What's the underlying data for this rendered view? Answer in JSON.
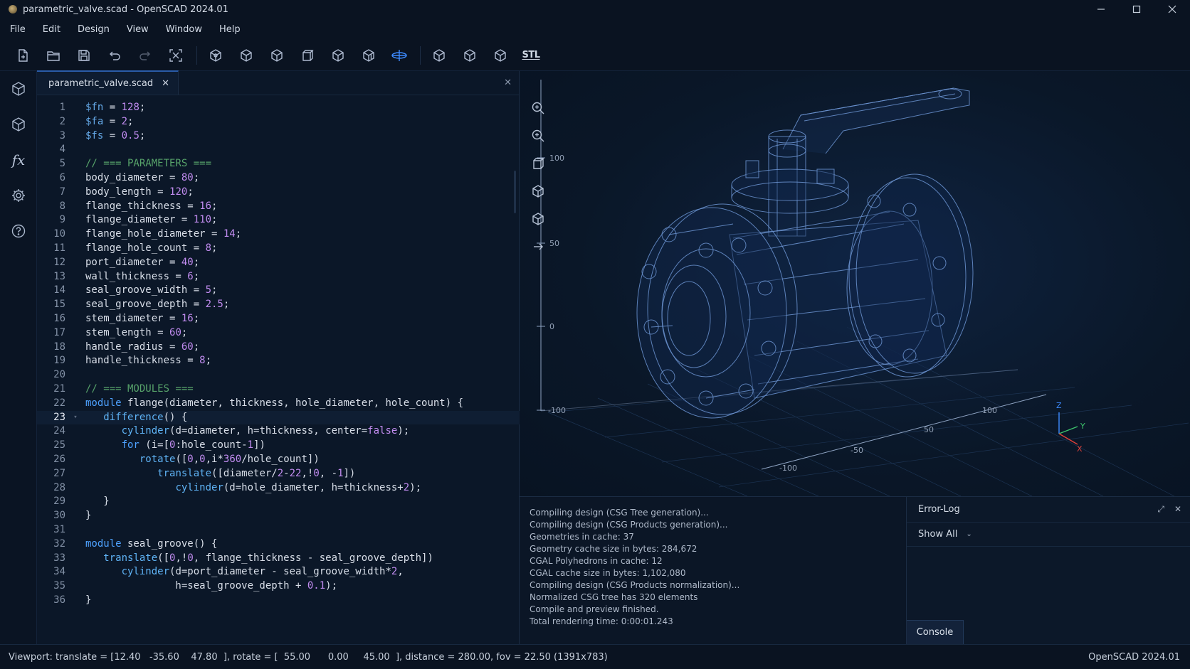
{
  "window": {
    "title": "parametric_valve.scad - OpenSCAD 2024.01",
    "controls": [
      "minimize",
      "maximize",
      "close"
    ]
  },
  "menu": [
    "File",
    "Edit",
    "Design",
    "View",
    "Window",
    "Help"
  ],
  "toolbar": {
    "stl_label": "STL",
    "active_tool": "axes"
  },
  "editor": {
    "tab_name": "parametric_valve.scad",
    "current_line": 23,
    "lines": [
      {
        "n": "1",
        "html": "<span class='tok-var'>$fn</span> = <span class='tok-num'>128</span>;"
      },
      {
        "n": "2",
        "html": "<span class='tok-var'>$fa</span> = <span class='tok-num'>2</span>;"
      },
      {
        "n": "3",
        "html": "<span class='tok-var'>$fs</span> = <span class='tok-num'>0.5</span>;"
      },
      {
        "n": "4",
        "html": ""
      },
      {
        "n": "5",
        "html": "<span class='tok-cmt'>// === PARAMETERS ===</span>"
      },
      {
        "n": "6",
        "html": "body_diameter = <span class='tok-num'>80</span>;"
      },
      {
        "n": "7",
        "html": "body_length = <span class='tok-num'>120</span>;"
      },
      {
        "n": "8",
        "html": "flange_thickness = <span class='tok-num'>16</span>;"
      },
      {
        "n": "9",
        "html": "flange_diameter = <span class='tok-num'>110</span>;"
      },
      {
        "n": "10",
        "html": "flange_hole_diameter = <span class='tok-num'>14</span>;"
      },
      {
        "n": "11",
        "html": "flange_hole_count = <span class='tok-num'>8</span>;"
      },
      {
        "n": "12",
        "html": "port_diameter = <span class='tok-num'>40</span>;"
      },
      {
        "n": "13",
        "html": "wall_thickness = <span class='tok-num'>6</span>;"
      },
      {
        "n": "14",
        "html": "seal_groove_width = <span class='tok-num'>5</span>;"
      },
      {
        "n": "15",
        "html": "seal_groove_depth = <span class='tok-num'>2.5</span>;"
      },
      {
        "n": "16",
        "html": "stem_diameter = <span class='tok-num'>16</span>;"
      },
      {
        "n": "17",
        "html": "stem_length = <span class='tok-num'>60</span>;"
      },
      {
        "n": "18",
        "html": "handle_radius = <span class='tok-num'>60</span>;"
      },
      {
        "n": "19",
        "html": "handle_thickness = <span class='tok-num'>8</span>;"
      },
      {
        "n": "20",
        "html": ""
      },
      {
        "n": "21",
        "html": "<span class='tok-cmt'>// === MODULES ===</span>"
      },
      {
        "n": "22",
        "html": "<span class='tok-kw'>module</span> flange(diameter, thickness, hole_diameter, hole_count) {"
      },
      {
        "n": "23",
        "html": "   <span class='tok-fn'>difference</span>() {"
      },
      {
        "n": "24",
        "html": "      <span class='tok-fn'>cylinder</span>(d=diameter, h=thickness, center=<span class='tok-num'>false</span>);"
      },
      {
        "n": "25",
        "html": "      <span class='tok-kw'>for</span> (i=[<span class='tok-num'>0</span>:hole_count-<span class='tok-num'>1</span>])"
      },
      {
        "n": "26",
        "html": "         <span class='tok-fn'>rotate</span>([<span class='tok-num'>0</span>,<span class='tok-num'>0</span>,i*<span class='tok-num'>360</span>/hole_count])"
      },
      {
        "n": "27",
        "html": "            <span class='tok-fn'>translate</span>([diameter/<span class='tok-num'>2</span>-<span class='tok-num'>22</span>,!<span class='tok-num'>0</span>, -<span class='tok-num'>1</span>])"
      },
      {
        "n": "28",
        "html": "               <span class='tok-fn'>cylinder</span>(d=hole_diameter, h=thickness+<span class='tok-num'>2</span>);"
      },
      {
        "n": "29",
        "html": "   }"
      },
      {
        "n": "30",
        "html": "}"
      },
      {
        "n": "31",
        "html": ""
      },
      {
        "n": "32",
        "html": "<span class='tok-kw'>module</span> seal_groove() {"
      },
      {
        "n": "33",
        "html": "   <span class='tok-fn'>translate</span>([<span class='tok-num'>0</span>,!<span class='tok-num'>0</span>, flange_thickness - seal_groove_depth])"
      },
      {
        "n": "34",
        "html": "      <span class='tok-fn'>cylinder</span>(d=port_diameter - seal_groove_width*<span class='tok-num'>2</span>,"
      },
      {
        "n": "35",
        "html": "               h=seal_groove_depth + <span class='tok-num'>0.1</span>);"
      },
      {
        "n": "36",
        "html": "}"
      }
    ]
  },
  "viewport": {
    "axis_labels": {
      "vertical": [
        "100",
        "50",
        "0",
        "-100"
      ],
      "floor_right": [
        "100",
        "50"
      ],
      "floor_front": [
        "-50",
        "-100"
      ],
      "gizmo": [
        "Z",
        "Y",
        "X"
      ]
    }
  },
  "console": {
    "lines": [
      "Compiling design (CSG Tree generation)...",
      "Compiling design (CSG Products generation)...",
      "Geometries in cache: 37",
      "Geometry cache size in bytes: 284,672",
      "CGAL Polyhedrons in cache: 12",
      "CGAL cache size in bytes: 1,102,080",
      "Compiling design (CSG Products normalization)...",
      "Normalized CSG tree has 320 elements",
      "Compile and preview finished.",
      "Total rendering time: 0:00:01.243"
    ]
  },
  "errorlog": {
    "title": "Error-Log",
    "filter": "Show All",
    "console_tab": "Console"
  },
  "status": {
    "left": "Viewport: translate = [12.40   -35.60    47.80  ], rotate = [  55.00      0.00     45.00  ], distance = 280.00, fov = 22.50 (1391x783)",
    "right": "OpenSCAD 2024.01"
  },
  "colors": {
    "accent": "#3d8bff",
    "background": "#0b1626",
    "wire": "#5c86c4"
  }
}
